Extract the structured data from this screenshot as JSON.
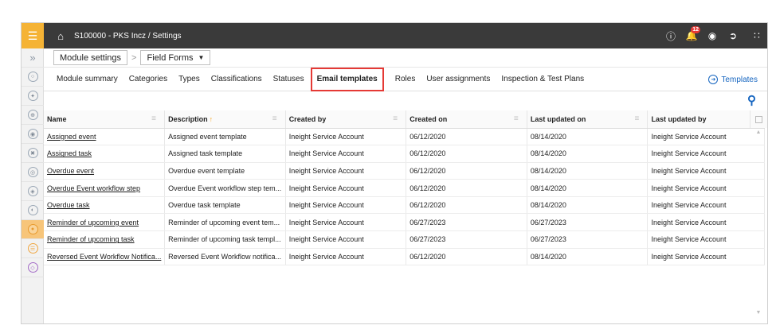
{
  "topbar": {
    "breadcrumb": "S100000 - PKS Incz  /  Settings",
    "notification_count": "12"
  },
  "module_row": {
    "module_settings_label": "Module settings",
    "field_forms_label": "Field Forms"
  },
  "tabs": [
    {
      "label": "Module summary"
    },
    {
      "label": "Categories"
    },
    {
      "label": "Types"
    },
    {
      "label": "Classifications"
    },
    {
      "label": "Statuses"
    },
    {
      "label": "Email templates",
      "active": true
    },
    {
      "label": "Roles"
    },
    {
      "label": "User assignments"
    },
    {
      "label": "Inspection & Test Plans"
    }
  ],
  "templates_link": "Templates",
  "table": {
    "headers": [
      "Name",
      "Description",
      "Created by",
      "Created on",
      "Last updated on",
      "Last updated by"
    ],
    "sort_marker": "↑",
    "rows": [
      [
        "Assigned event",
        "Assigned event template",
        "Ineight Service Account",
        "06/12/2020",
        "08/14/2020",
        "Ineight Service Account"
      ],
      [
        "Assigned task",
        "Assigned task template",
        "Ineight Service Account",
        "06/12/2020",
        "08/14/2020",
        "Ineight Service Account"
      ],
      [
        "Overdue event",
        "Overdue event template",
        "Ineight Service Account",
        "06/12/2020",
        "08/14/2020",
        "Ineight Service Account"
      ],
      [
        "Overdue Event workflow step",
        "Overdue Event workflow step tem...",
        "Ineight Service Account",
        "06/12/2020",
        "08/14/2020",
        "Ineight Service Account"
      ],
      [
        "Overdue task",
        "Overdue task template",
        "Ineight Service Account",
        "06/12/2020",
        "08/14/2020",
        "Ineight Service Account"
      ],
      [
        "Reminder of upcoming event",
        "Reminder of upcoming event tem...",
        "Ineight Service Account",
        "06/27/2023",
        "06/27/2023",
        "Ineight Service Account"
      ],
      [
        "Reminder of upcoming task",
        "Reminder of upcoming task templ...",
        "Ineight Service Account",
        "06/27/2023",
        "06/27/2023",
        "Ineight Service Account"
      ],
      [
        "Reversed Event Workflow Notifica...",
        "Reversed Event Workflow notifica...",
        "Ineight Service Account",
        "06/12/2020",
        "08/14/2020",
        "Ineight Service Account"
      ]
    ]
  },
  "colors": {
    "accent_orange": "#f5b335",
    "topbar_bg": "#3a3a3a",
    "link_blue": "#1565c0",
    "highlight_red": "#e53935"
  }
}
